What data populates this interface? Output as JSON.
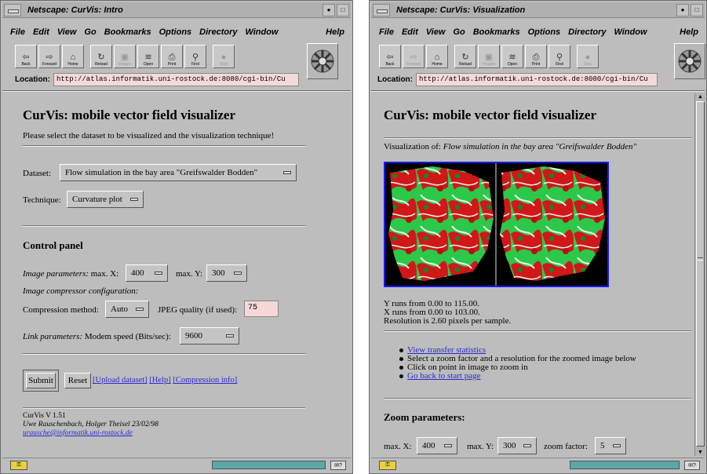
{
  "menu": [
    "File",
    "Edit",
    "View",
    "Go",
    "Bookmarks",
    "Options",
    "Directory",
    "Window"
  ],
  "menu_help": "Help",
  "toolbar": [
    "Back",
    "Forward",
    "Home",
    "Reload",
    "Images",
    "Open",
    "Print",
    "Find",
    "Stop"
  ],
  "location_label": "Location:",
  "location_url": "http://atlas.informatik.uni-rostock.de:8080/cgi-bin/Cu",
  "window1": {
    "title": "Netscape: CurVis: Intro",
    "heading": "CurVis: mobile vector field visualizer",
    "intro": "Please select the dataset to be visualized and the visualization technique!",
    "dataset_label": "Dataset:",
    "dataset_value": "Flow simulation in the bay area \"Greifswalder Bodden\"",
    "technique_label": "Technique:",
    "technique_value": "Curvature plot",
    "control_panel": "Control panel",
    "image_params_label": "Image parameters:",
    "maxx_label": "max. X:",
    "maxx_value": "400",
    "maxy_label": "max. Y:",
    "maxy_value": "300",
    "compressor_label": "Image compressor configuration:",
    "compression_label": "Compression method:",
    "compression_value": "Auto",
    "jpeg_label": "JPEG quality (if used):",
    "jpeg_value": "75",
    "link_label": "Link parameters:",
    "modem_label": "Modem speed (Bits/sec):",
    "modem_value": "9600",
    "submit": "Submit",
    "reset": "Reset",
    "link_upload": "[Upload dataset]",
    "link_help": "[Help]",
    "link_compression": "[Compression info]",
    "footer_version": "CurVis V 1.51",
    "footer_authors": "Uwe Rauschenbach, Holger Theisel 23/02/98",
    "footer_email": "urausche@informatik.uni-rostock.de"
  },
  "window2": {
    "title": "Netscape: CurVis: Visualization",
    "heading": "CurVis: mobile vector field visualizer",
    "viz_of_label": "Visualization of:",
    "viz_of_value": "Flow simulation in the bay area \"Greifswalder Bodden\"",
    "y_runs": "Y runs from 0.00 to 115.00.",
    "x_runs": "X runs from 0.00 to 103.00.",
    "resolution": "Resolution is 2.60 pixels per sample.",
    "bullet_transfer": "View transfer statistics",
    "bullet_zoom": "Select a zoom factor and a resolution for the zoomed image below",
    "bullet_click": "Click on point in image to zoom in",
    "bullet_back": "Go back to start page",
    "zoom_heading": "Zoom parameters:",
    "maxx_label": "max. X:",
    "maxx_value": "400",
    "maxy_label": "max. Y:",
    "maxy_value": "300",
    "zoom_factor_label": "zoom factor:",
    "zoom_factor_value": "5"
  },
  "colors": {
    "accent_link": "#2a2ad0",
    "image_border": "#1a1aee",
    "field_bg": "#f6d8d8",
    "status_bar": "#58a8a8"
  }
}
